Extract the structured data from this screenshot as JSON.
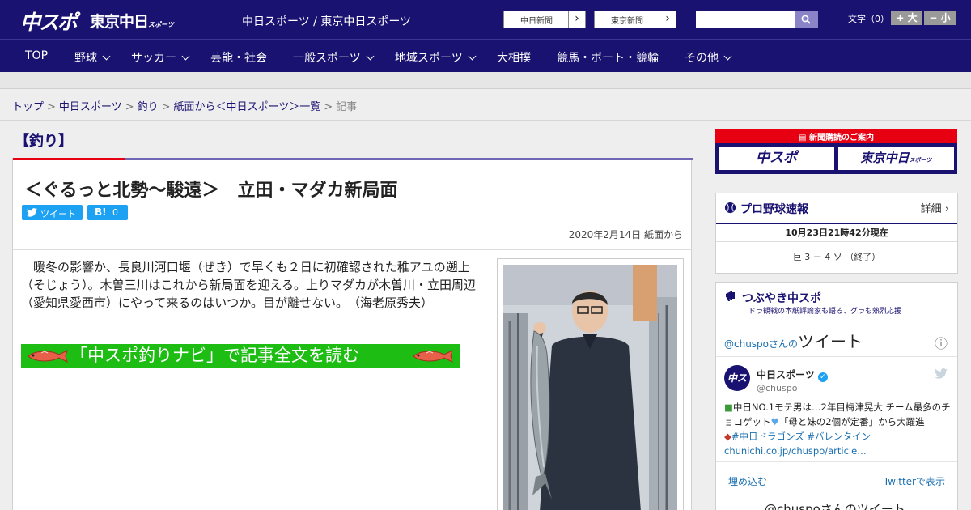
{
  "header": {
    "logo_chuspo": "中スポ",
    "logo_tokyo": "東京中日",
    "logo_tokyo_small": "スポーツ",
    "site_name": "中日スポーツ / 東京中日スポーツ",
    "ext_links": [
      {
        "label": "中日新聞",
        "arrow": "›"
      },
      {
        "label": "東京新聞",
        "arrow": "›"
      }
    ],
    "search_placeholder": "",
    "text_size_label": "文字（0）",
    "text_size_plus": "+ 大",
    "text_size_minus": "− 小"
  },
  "nav": {
    "items": [
      {
        "label": "TOP",
        "has_dropdown": false
      },
      {
        "label": "野球",
        "has_dropdown": true
      },
      {
        "label": "サッカー",
        "has_dropdown": true
      },
      {
        "label": "芸能・社会",
        "has_dropdown": false
      },
      {
        "label": "一般スポーツ",
        "has_dropdown": true
      },
      {
        "label": "地域スポーツ",
        "has_dropdown": true
      },
      {
        "label": "大相撲",
        "has_dropdown": false
      },
      {
        "label": "競馬・ボート・競輪",
        "has_dropdown": false
      },
      {
        "label": "その他",
        "has_dropdown": true
      }
    ]
  },
  "breadcrumb": {
    "items": [
      "トップ",
      "中日スポーツ",
      "釣り",
      "紙面から＜中日スポーツ＞一覧"
    ],
    "separator": ">",
    "current": "記事"
  },
  "article": {
    "category": "【釣り】",
    "headline": "＜ぐるっと北勢～駿遠＞　立田・マダカ新局面",
    "tweet_label": "ツイート",
    "hatena_label": "B!",
    "hatena_count": "0",
    "date": "2020年2月14日 紙面から",
    "body": "　暖冬の影響か、長良川河口堰（ぜき）で早くも２日に初確認された稚アユの遡上（そじょう）。木曽三川はこれから新局面を迎える。上りマダカが木曽川・立田周辺（愛知県愛西市）にやって来るのはいつか。目が離せない。　（海老原秀夫）",
    "navi_banner": "「中スポ釣りナビ」で記事全文を読む"
  },
  "sidebar": {
    "subscribe_top": "新聞購読のご案内",
    "subscribe_chuspo": "中スポ",
    "subscribe_tokyo": "東京中日",
    "subscribe_tokyo_small": "スポーツ",
    "baseball": {
      "title": "プロ野球速報",
      "more": "詳細 ›",
      "timestamp": "10月23日21時42分現在",
      "score": "巨 3 － 4 ソ （終了）"
    },
    "tsubuyaki": {
      "title": "つぶやき中スポ",
      "subtitle": "ドラ観戦の本紙評論家も語る、グラも熱烈応援",
      "tweets_header_handle": "@chuspoさんの",
      "tweets_header": "ツイート",
      "info_icon": "ⓘ",
      "account_name": "中日スポーツ",
      "account_handle": "@chuspo",
      "tweet_text_1": "中日NO.1モテ男は…2年目梅津晃大 チーム最多のチョコゲット",
      "tweet_text_2": "「母と妹の2個が定番」から大躍進",
      "tweet_tags": "#中日ドラゴンズ #バレンタイン",
      "tweet_link": "chunichi.co.jp/chuspo/article…",
      "embed_label": "埋め込む",
      "view_on_twitter": "Twitterで表示",
      "footer": "@chuspoさんのツイート"
    }
  },
  "colors": {
    "brand_navy": "#1a1270",
    "accent_red": "#e60012",
    "accent_purple": "#6f67b3",
    "twitter_blue": "#1da1f2",
    "navi_green": "#1dbd14"
  }
}
